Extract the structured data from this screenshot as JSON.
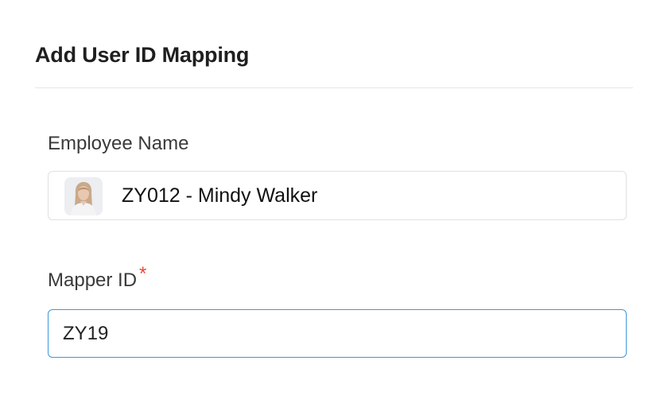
{
  "dialog": {
    "title": "Add User ID Mapping"
  },
  "form": {
    "employee": {
      "label": "Employee Name",
      "value": "ZY012 - Mindy Walker",
      "avatar_icon": "user-photo-avatar"
    },
    "mapper": {
      "label": "Mapper ID",
      "required_mark": "*",
      "value": "ZY19"
    }
  },
  "colors": {
    "required": "#e5483a",
    "focus_border": "#3f97dc",
    "divider": "#e6e6e6"
  }
}
